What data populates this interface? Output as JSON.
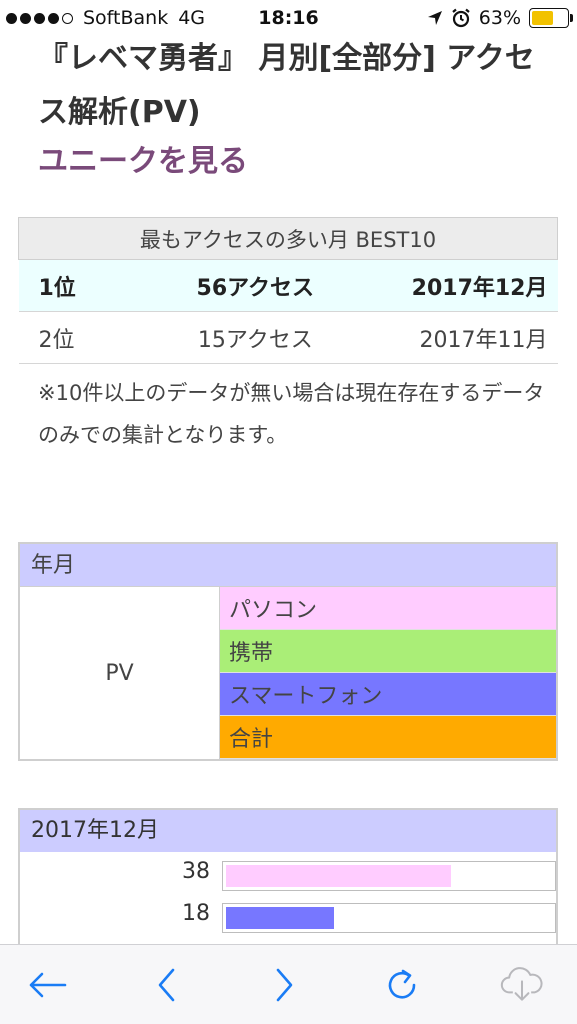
{
  "status_bar": {
    "carrier": "SoftBank",
    "network": "4G",
    "time": "18:16",
    "battery_percent": "63%",
    "battery_level": 0.63,
    "icons": [
      "signal-dots-icon",
      "location-arrow-icon",
      "alarm-icon",
      "battery-icon"
    ]
  },
  "page": {
    "title": "『レベマ勇者』 月別[全部分] アクセス解析(PV)",
    "unique_link": "ユニークを見る"
  },
  "best_table": {
    "header": "最もアクセスの多い月 BEST10",
    "rows": [
      {
        "rank": "1位",
        "access": "56アクセス",
        "month": "2017年12月"
      },
      {
        "rank": "2位",
        "access": "15アクセス",
        "month": "2017年11月"
      }
    ]
  },
  "note": "※10件以上のデータが無い場合は現在存在するデータのみでの集計となります。",
  "legend": {
    "header": "年月",
    "pv_label": "PV",
    "categories": [
      {
        "label": "パソコン",
        "color": "#ffccff"
      },
      {
        "label": "携帯",
        "color": "#aaee77"
      },
      {
        "label": "スマートフォン",
        "color": "#7777ff"
      },
      {
        "label": "合計",
        "color": "#ffaa00"
      }
    ]
  },
  "chart_data": {
    "type": "bar",
    "title": "2017年12月",
    "bars": [
      {
        "value": 38,
        "color": "#ffccff",
        "fraction": 0.69
      },
      {
        "value": 18,
        "color": "#7777ff",
        "fraction": 0.33
      }
    ]
  },
  "toolbar": {
    "icons": [
      "back-arrow-icon",
      "chevron-left-icon",
      "chevron-right-icon",
      "reload-icon",
      "cloud-download-icon"
    ]
  }
}
